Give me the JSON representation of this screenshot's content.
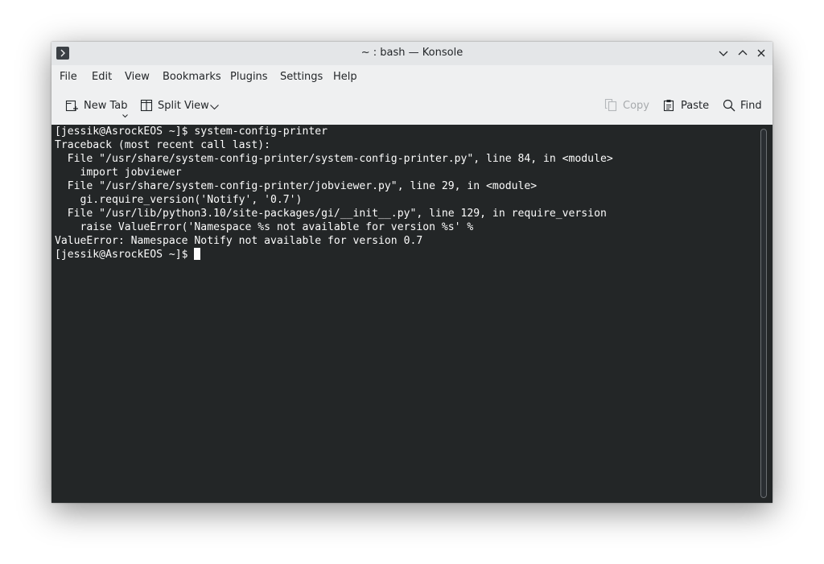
{
  "window": {
    "title": "~ : bash — Konsole",
    "app_icon": "konsole-icon",
    "controls": [
      "minimize-icon",
      "maximize-icon",
      "close-icon"
    ]
  },
  "menu": {
    "items": [
      {
        "label": "File"
      },
      {
        "label": "Edit"
      },
      {
        "label": "View"
      },
      {
        "label": "Bookmarks"
      },
      {
        "label": "Plugins"
      },
      {
        "label": "Settings"
      },
      {
        "label": "Help"
      }
    ]
  },
  "toolbar": {
    "new_tab": {
      "label": "New Tab",
      "icon": "new-tab-icon"
    },
    "split_view": {
      "label": "Split View",
      "icon": "split-view-icon"
    },
    "copy": {
      "label": "Copy",
      "icon": "copy-icon",
      "enabled": false
    },
    "paste": {
      "label": "Paste",
      "icon": "paste-icon"
    },
    "find": {
      "label": "Find",
      "icon": "search-icon"
    }
  },
  "terminal": {
    "lines": [
      "[jessik@AsrockEOS ~]$ system-config-printer",
      "Traceback (most recent call last):",
      "  File \"/usr/share/system-config-printer/system-config-printer.py\", line 84, in <module>",
      "    import jobviewer",
      "  File \"/usr/share/system-config-printer/jobviewer.py\", line 29, in <module>",
      "    gi.require_version('Notify', '0.7')",
      "  File \"/usr/lib/python3.10/site-packages/gi/__init__.py\", line 129, in require_version",
      "    raise ValueError('Namespace %s not available for version %s' %",
      "ValueError: Namespace Notify not available for version 0.7"
    ],
    "prompt": "[jessik@AsrockEOS ~]$"
  },
  "colors": {
    "terminal_bg": "#232627",
    "terminal_fg": "#fcfcfc",
    "chrome_bg": "#eff0f1"
  }
}
